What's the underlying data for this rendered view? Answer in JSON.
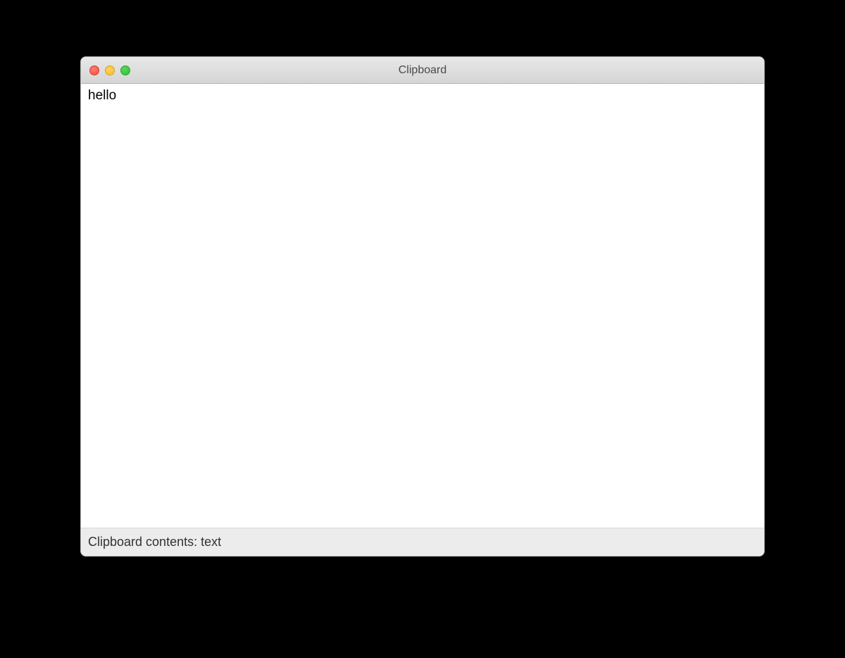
{
  "window": {
    "title": "Clipboard"
  },
  "content": {
    "text": "hello"
  },
  "statusbar": {
    "label": "Clipboard contents: text"
  }
}
